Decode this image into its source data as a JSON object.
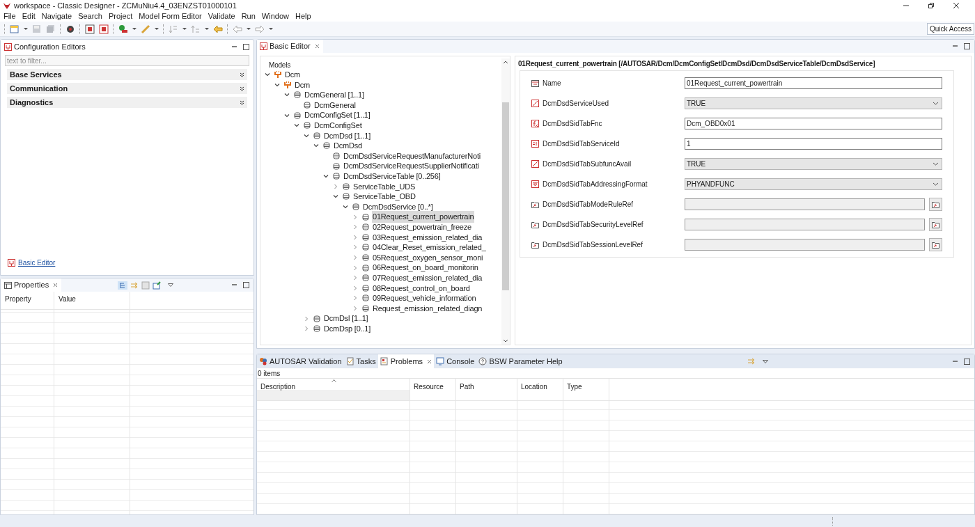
{
  "window": {
    "title": "workspace - Classic Designer - ZCMuNiu4.4_03ENZST01000101"
  },
  "menu": [
    "File",
    "Edit",
    "Navigate",
    "Search",
    "Project",
    "Model Form Editor",
    "Validate",
    "Run",
    "Window",
    "Help"
  ],
  "quick_access": "Quick Access",
  "config_editors": {
    "title": "Configuration Editors",
    "filter_placeholder": "text to filter...",
    "sections": [
      {
        "label": "Base Services",
        "expanded": false
      },
      {
        "label": "Communication",
        "expanded": false
      },
      {
        "label": "Diagnostics",
        "expanded": false
      }
    ],
    "link": "Basic Editor"
  },
  "properties": {
    "title": "Properties",
    "columns": [
      "Property",
      "Value"
    ]
  },
  "basic_editor": {
    "tab": "Basic Editor",
    "tree_heading": "Models",
    "tree": [
      {
        "label": "Dcm",
        "kind": "module",
        "expanded": true,
        "selected": false,
        "children": [
          {
            "label": "Dcm",
            "kind": "module",
            "expanded": true,
            "selected": false,
            "children": [
              {
                "label": "DcmGeneral [1..1]",
                "kind": "container",
                "expanded": true,
                "selected": false,
                "children": [
                  {
                    "label": "DcmGeneral",
                    "kind": "container",
                    "selected": false
                  }
                ]
              },
              {
                "label": "DcmConfigSet [1..1]",
                "kind": "container",
                "expanded": true,
                "selected": false,
                "children": [
                  {
                    "label": "DcmConfigSet",
                    "kind": "container",
                    "expanded": true,
                    "selected": false,
                    "children": [
                      {
                        "label": "DcmDsd [1..1]",
                        "kind": "container",
                        "expanded": true,
                        "selected": false,
                        "children": [
                          {
                            "label": "DcmDsd",
                            "kind": "container",
                            "expanded": true,
                            "selected": false,
                            "children": [
                              {
                                "label": "DcmDsdServiceRequestManufacturerNoti",
                                "kind": "container",
                                "selected": false
                              },
                              {
                                "label": "DcmDsdServiceRequestSupplierNotificati",
                                "kind": "container",
                                "selected": false
                              },
                              {
                                "label": "DcmDsdServiceTable [0..256]",
                                "kind": "container",
                                "expanded": true,
                                "selected": false,
                                "children": [
                                  {
                                    "label": "ServiceTable_UDS",
                                    "kind": "container",
                                    "expanded": false,
                                    "selected": false
                                  },
                                  {
                                    "label": "ServiceTable_OBD",
                                    "kind": "container",
                                    "expanded": true,
                                    "selected": false,
                                    "children": [
                                      {
                                        "label": "DcmDsdService [0..*]",
                                        "kind": "container",
                                        "expanded": true,
                                        "selected": false,
                                        "children": [
                                          {
                                            "label": "01Request_current_powertrain",
                                            "kind": "container",
                                            "expanded": false,
                                            "selected": true
                                          },
                                          {
                                            "label": "02Request_powertrain_freeze",
                                            "kind": "container",
                                            "expanded": false,
                                            "selected": false
                                          },
                                          {
                                            "label": "03Request_emission_related_dia",
                                            "kind": "container",
                                            "expanded": false,
                                            "selected": false
                                          },
                                          {
                                            "label": "04Clear_Reset_emission_related_",
                                            "kind": "container",
                                            "expanded": false,
                                            "selected": false
                                          },
                                          {
                                            "label": "05Request_oxygen_sensor_moni",
                                            "kind": "container",
                                            "expanded": false,
                                            "selected": false
                                          },
                                          {
                                            "label": "06Request_on_board_monitorin",
                                            "kind": "container",
                                            "expanded": false,
                                            "selected": false
                                          },
                                          {
                                            "label": "07Request_emission_related_dia",
                                            "kind": "container",
                                            "expanded": false,
                                            "selected": false
                                          },
                                          {
                                            "label": "08Request_control_on_board",
                                            "kind": "container",
                                            "expanded": false,
                                            "selected": false
                                          },
                                          {
                                            "label": "09Request_vehicle_information",
                                            "kind": "container",
                                            "expanded": false,
                                            "selected": false
                                          },
                                          {
                                            "label": "Request_emission_related_diagn",
                                            "kind": "container",
                                            "expanded": false,
                                            "selected": false
                                          }
                                        ]
                                      }
                                    ]
                                  }
                                ]
                              }
                            ]
                          }
                        ]
                      },
                      {
                        "label": "DcmDsl [1..1]",
                        "kind": "container",
                        "expanded": false,
                        "selected": false
                      },
                      {
                        "label": "DcmDsp [0..1]",
                        "kind": "container",
                        "expanded": false,
                        "selected": false
                      }
                    ]
                  }
                ]
              }
            ]
          }
        ]
      }
    ],
    "detail_heading": "01Request_current_powertrain [/AUTOSAR/Dcm/DcmConfigSet/DcmDsd/DcmDsdServiceTable/DcmDsdService]",
    "fields": [
      {
        "kind": "name",
        "label": "Name",
        "value": "01Request_current_powertrain"
      },
      {
        "kind": "boolean",
        "label": "DcmDsdServiceUsed",
        "value": "TRUE"
      },
      {
        "kind": "function",
        "label": "DcmDsdSidTabFnc",
        "value": "Dcm_OBD0x01"
      },
      {
        "kind": "integer",
        "label": "DcmDsdSidTabServiceId",
        "value": "1"
      },
      {
        "kind": "boolean",
        "label": "DcmDsdSidTabSubfuncAvail",
        "value": "TRUE"
      },
      {
        "kind": "enum",
        "label": "DcmDsdSidTabAddressingFormat",
        "value": "PHYANDFUNC"
      },
      {
        "kind": "reference",
        "label": "DcmDsdSidTabModeRuleRef"
      },
      {
        "kind": "reference",
        "label": "DcmDsdSidTabSecurityLevelRef"
      },
      {
        "kind": "reference",
        "label": "DcmDsdSidTabSessionLevelRef"
      }
    ]
  },
  "bottom_panel": {
    "tabs": [
      {
        "label": "AUTOSAR Validation",
        "kind": "validation",
        "selected": false
      },
      {
        "label": "Tasks",
        "kind": "tasks",
        "selected": false
      },
      {
        "label": "Problems",
        "kind": "problems",
        "selected": true
      },
      {
        "label": "Console",
        "kind": "console",
        "selected": false
      },
      {
        "label": "BSW Parameter Help",
        "kind": "help",
        "selected": false
      }
    ],
    "summary": "0 items",
    "columns": [
      "Description",
      "Resource",
      "Path",
      "Location",
      "Type"
    ]
  }
}
